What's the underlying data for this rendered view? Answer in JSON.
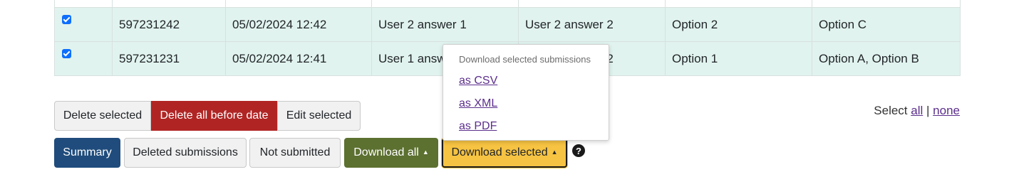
{
  "table": {
    "rows": [
      {
        "id": "597231242",
        "date": "05/02/2024 12:42",
        "answer1": "User 2 answer 1",
        "answer2": "User 2 answer 2",
        "choice": "Option 2",
        "multi": "Option C"
      },
      {
        "id": "597231231",
        "date": "05/02/2024 12:41",
        "answer1": "User 1 answer 1",
        "answer2": "User 1 answer 2",
        "choice": "Option 1",
        "multi": "Option A, Option B"
      }
    ]
  },
  "actions": {
    "delete_selected": "Delete selected",
    "delete_all_before_date": "Delete all before date",
    "edit_selected": "Edit selected"
  },
  "select": {
    "prefix": "Select",
    "all": "all",
    "separator": "|",
    "none": "none"
  },
  "toolbar": {
    "summary": "Summary",
    "deleted_submissions": "Deleted submissions",
    "not_submitted": "Not submitted",
    "download_all": "Download all",
    "download_selected": "Download selected",
    "help": "?"
  },
  "dropdown": {
    "header": "Download selected submissions",
    "items": [
      "as CSV",
      "as XML",
      "as PDF"
    ]
  },
  "colors": {
    "row_bg": "#e1f3ee",
    "delete_all": "#b02524",
    "summary": "#1f4c7c",
    "download_all": "#5c7030",
    "download_selected": "#f6c342",
    "link": "#5b2e8c"
  }
}
